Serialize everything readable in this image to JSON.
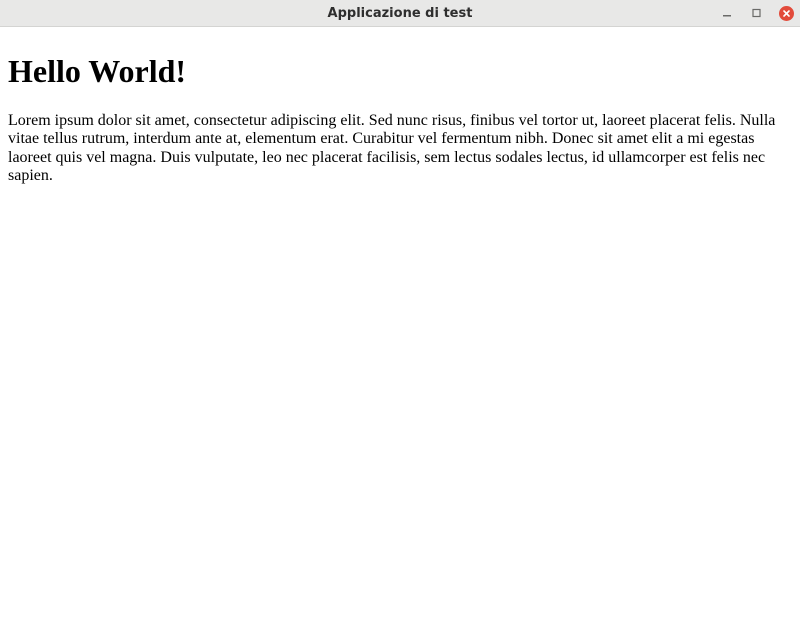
{
  "window": {
    "title": "Applicazione di test"
  },
  "content": {
    "heading": "Hello World!",
    "paragraph": "Lorem ipsum dolor sit amet, consectetur adipiscing elit. Sed nunc risus, finibus vel tortor ut, laoreet placerat felis. Nulla vitae tellus rutrum, interdum ante at, elementum erat. Curabitur vel fermentum nibh. Donec sit amet elit a mi egestas laoreet quis vel magna. Duis vulputate, leo nec placerat facilisis, sem lectus sodales lectus, id ullamcorper est felis nec sapien."
  }
}
